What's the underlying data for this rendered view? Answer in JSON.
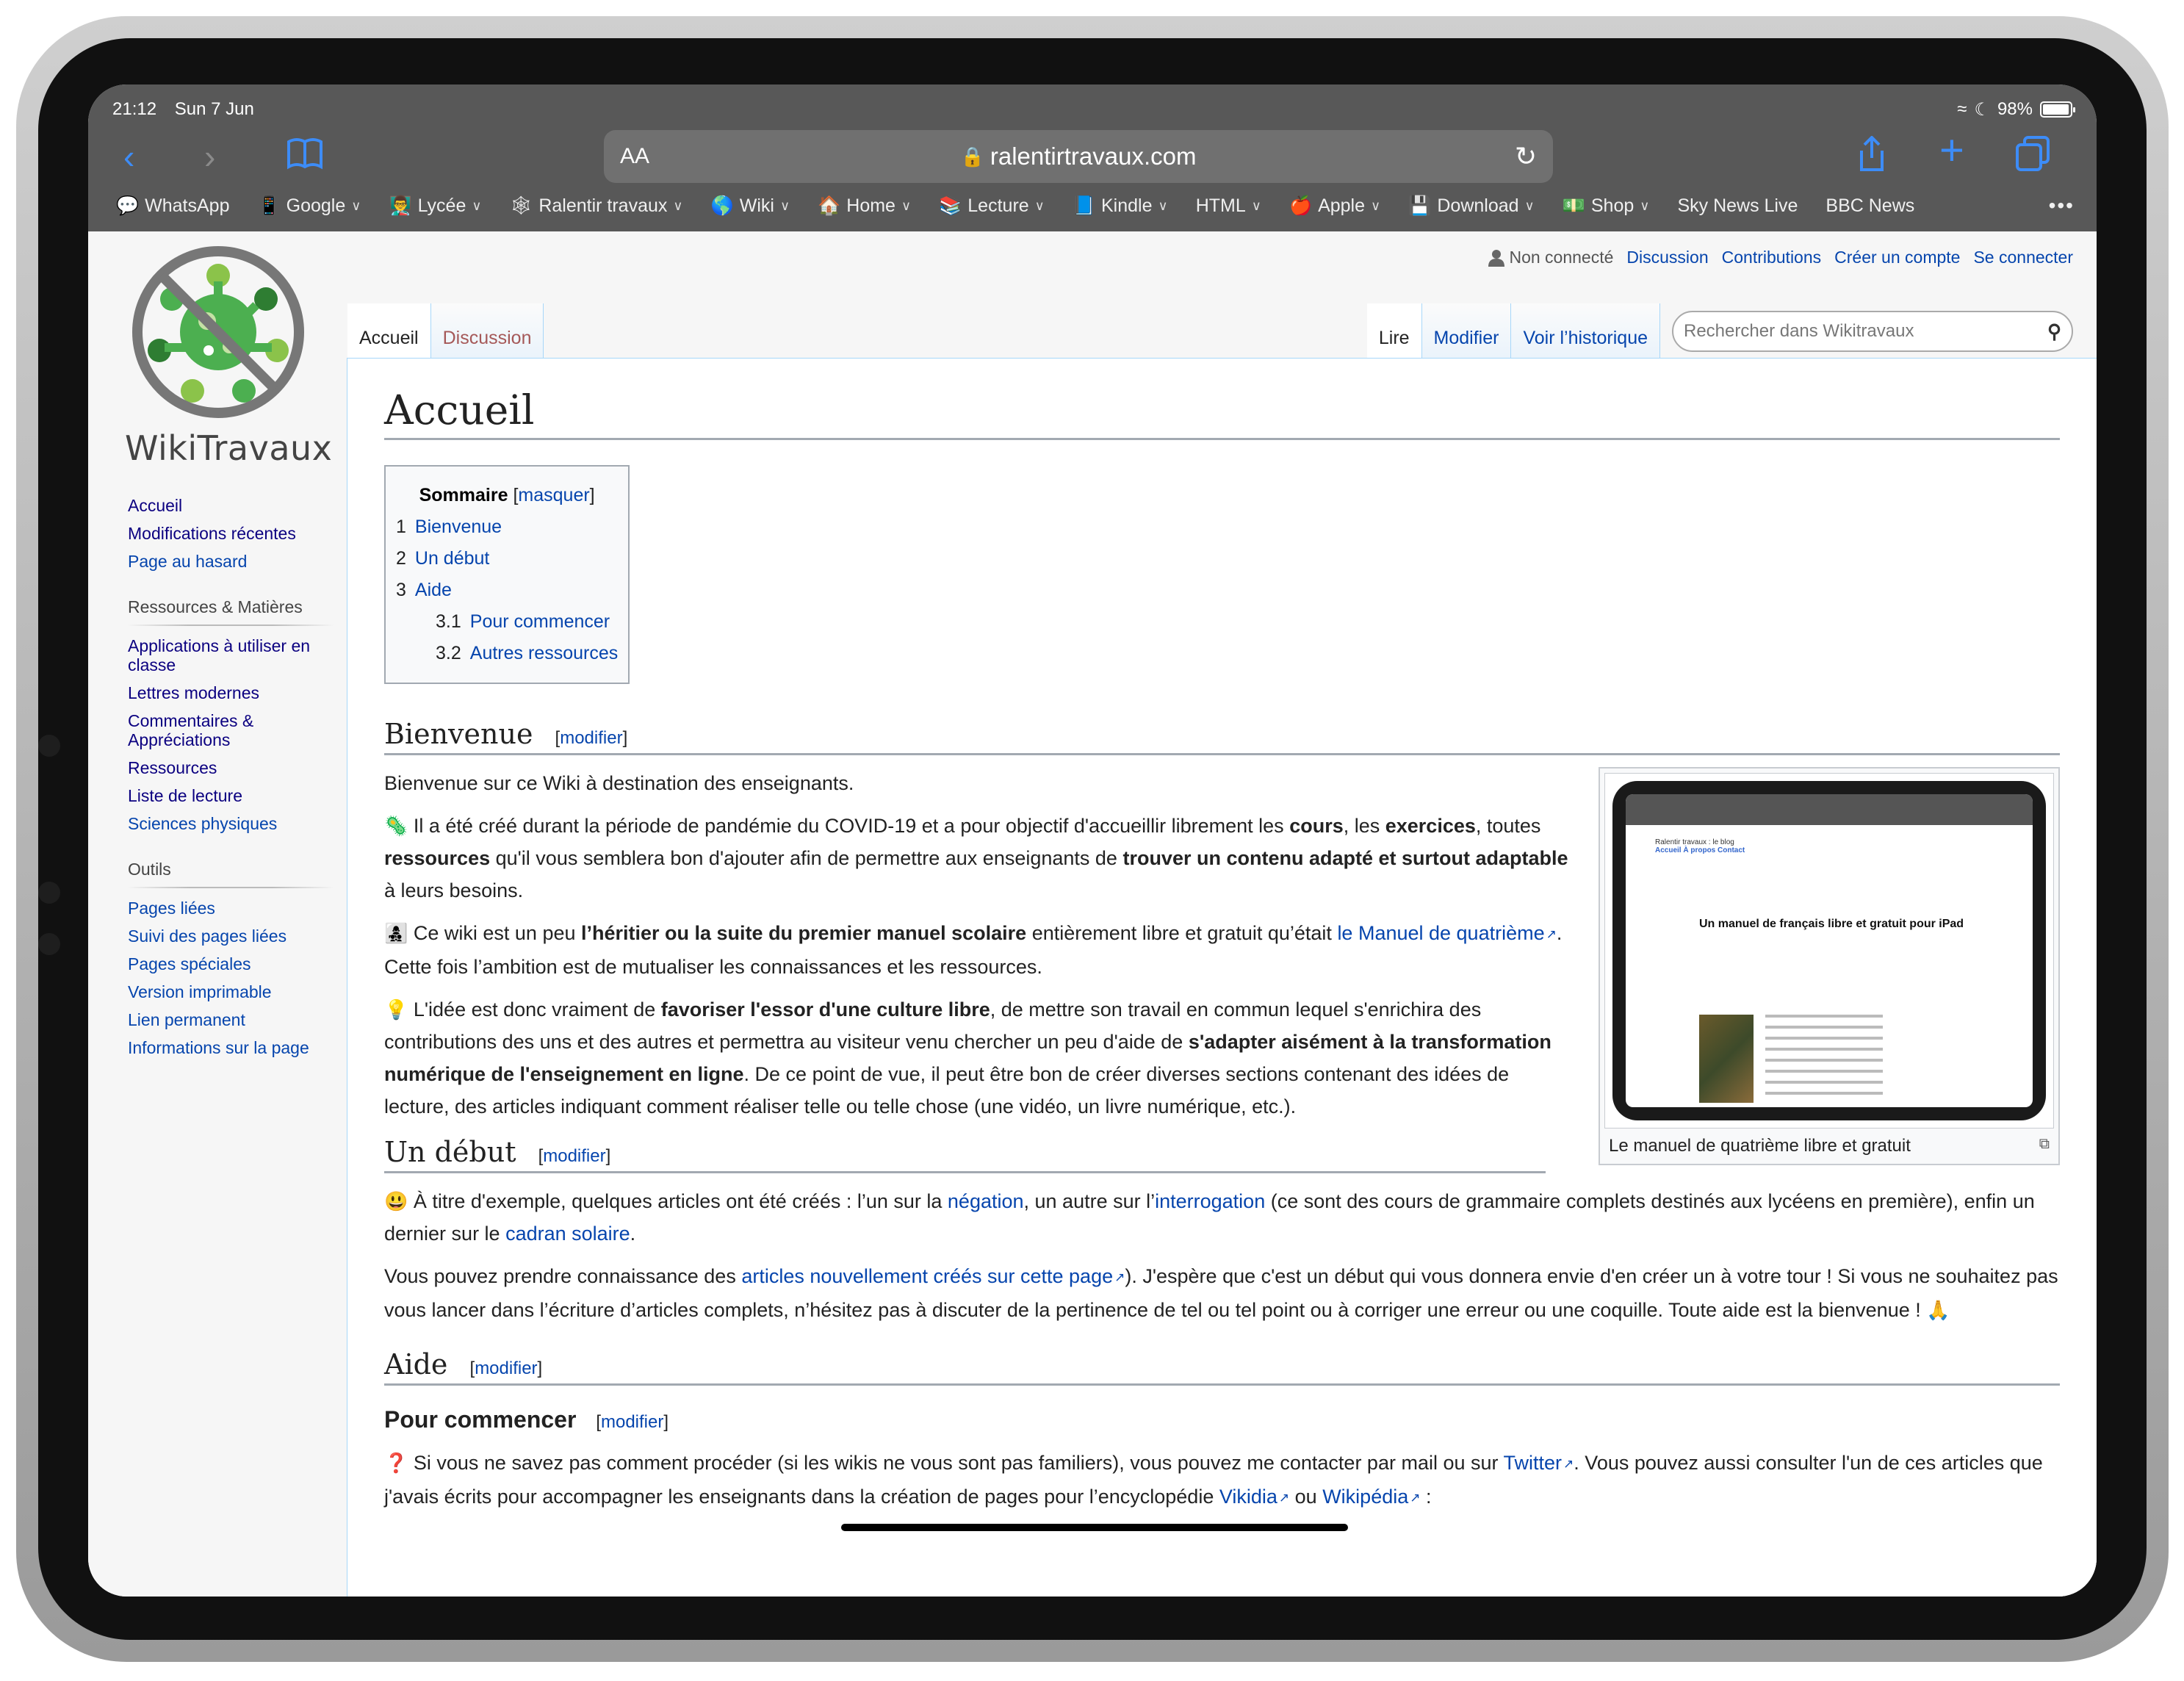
{
  "status_bar": {
    "time": "21:12",
    "date": "Sun 7 Jun",
    "battery": "98%",
    "battery_level": 0.98,
    "icons": [
      "wifi-icon",
      "moon-icon",
      "battery-icon"
    ]
  },
  "browser": {
    "url": "ralentirtravaux.com",
    "text_size_label": "AA",
    "icons": {
      "back": "‹",
      "forward": "›",
      "bookmarks": "book-icon",
      "share": "share-icon",
      "new_tab": "+",
      "tabs": "tabs-icon",
      "reload": "↻",
      "lock": "lock-icon"
    },
    "bookmarks": [
      {
        "label": "WhatsApp",
        "icon": "💬",
        "menu": false
      },
      {
        "label": "Google",
        "icon": "📱",
        "menu": true
      },
      {
        "label": "Lycée",
        "icon": "👨‍🏫",
        "menu": true
      },
      {
        "label": "Ralentir travaux",
        "icon": "🕸",
        "menu": true
      },
      {
        "label": "Wiki",
        "icon": "🌎",
        "menu": true
      },
      {
        "label": "Home",
        "icon": "🏠",
        "menu": true
      },
      {
        "label": "Lecture",
        "icon": "📚",
        "menu": true
      },
      {
        "label": "Kindle",
        "icon": "📘",
        "menu": true
      },
      {
        "label": "HTML",
        "icon": "",
        "menu": true
      },
      {
        "label": "Apple",
        "icon": "🍎",
        "menu": true
      },
      {
        "label": "Download",
        "icon": "💾",
        "menu": true
      },
      {
        "label": "Shop",
        "icon": "💵",
        "menu": true
      },
      {
        "label": "Sky News Live",
        "icon": "",
        "menu": false
      },
      {
        "label": "BBC News",
        "icon": "",
        "menu": false
      }
    ],
    "more_label": "•••"
  },
  "wiki": {
    "site_name": "WikiTravaux",
    "personal": {
      "status": "Non connecté",
      "links": [
        "Discussion",
        "Contributions",
        "Créer un compte",
        "Se connecter"
      ]
    },
    "namespace_tabs": [
      {
        "label": "Accueil",
        "selected": true
      },
      {
        "label": "Discussion",
        "selected": false
      }
    ],
    "view_tabs": [
      {
        "label": "Lire",
        "selected": true
      },
      {
        "label": "Modifier",
        "selected": false
      },
      {
        "label": "Voir l’historique",
        "selected": false
      }
    ],
    "search_placeholder": "Rechercher dans Wikitravaux",
    "sidebar": {
      "navigation": [
        "Accueil",
        "Modifications récentes",
        "Page au hasard"
      ],
      "ressources": {
        "title": "Ressources & Matières",
        "items": [
          "Applications à utiliser en classe",
          "Lettres modernes",
          "Commentaires & Appréciations",
          "Ressources",
          "Liste de lecture",
          "Sciences physiques"
        ]
      },
      "outils": {
        "title": "Outils",
        "items": [
          "Pages liées",
          "Suivi des pages liées",
          "Pages spéciales",
          "Version imprimable",
          "Lien permanent",
          "Informations sur la page"
        ]
      }
    },
    "page_title": "Accueil",
    "toc": {
      "title": "Sommaire",
      "toggle": "masquer",
      "entries": [
        {
          "num": "1",
          "label": "Bienvenue",
          "level": 1
        },
        {
          "num": "2",
          "label": "Un début",
          "level": 1
        },
        {
          "num": "3",
          "label": "Aide",
          "level": 1
        },
        {
          "num": "3.1",
          "label": "Pour commencer",
          "level": 2
        },
        {
          "num": "3.2",
          "label": "Autres ressources",
          "level": 2
        }
      ]
    },
    "edit_label": "modifier",
    "sections": {
      "bienvenue": {
        "title": "Bienvenue",
        "intro": "Bienvenue sur ce Wiki à destination des enseignants.",
        "p1": {
          "emoji": "🦠",
          "t1": " Il a été créé durant la période de pandémie du COVID-19 et a pour objectif d'accueillir librement les ",
          "b1": "cours",
          "t2": ", les ",
          "b2": "exercices",
          "t3": ", toutes ",
          "b3": "ressources",
          "t4": " qu'il vous semblera bon d'ajouter afin de permettre aux enseignants de ",
          "b4": "trouver un contenu adapté et surtout adaptable",
          "t5": " à leurs besoins."
        },
        "p2": {
          "emoji": "👩‍👧‍👦",
          "t1": " Ce wiki est un peu ",
          "b1": "l’héritier ou la suite du premier manuel scolaire",
          "t2": " entièrement libre et gratuit qu’était ",
          "link": "le Manuel de quatrième",
          "t3": ". Cette fois l’ambition est de mutualiser les connaissances et les ressources."
        },
        "p3": {
          "emoji": "💡",
          "t1": " L'idée est donc vraiment de ",
          "b1": "favoriser l'essor d'une culture libre",
          "t2": ", de mettre son travail en commun lequel s'enrichira des contributions des uns et des autres et permettra au visiteur venu chercher un peu d'aide de ",
          "b2": "s'adapter aisément à la transformation numérique de l'enseignement en ligne",
          "t3": ". De ce point de vue, il peut être bon de créer diverses sections contenant des idées de lecture, des articles indiquant comment réaliser telle ou telle chose (une vidéo, un livre numérique, etc.)."
        },
        "thumb": {
          "caption": "Le manuel de quatrième libre et gratuit",
          "inner_blog": "Ralentir travaux : le blog",
          "inner_nav": "Accueil  À propos  Contact",
          "inner_title": "Un manuel de français libre et gratuit pour iPad"
        }
      },
      "debut": {
        "title": "Un début",
        "p1": {
          "emoji": "😃",
          "t1": " À titre d'exemple, quelques articles ont été créés : l’un sur la ",
          "l1": "négation",
          "t2": ", un autre sur l’",
          "l2": "interrogation",
          "t3": " (ce sont des cours de grammaire complets destinés aux lycéens en première), enfin un dernier sur le ",
          "l3": "cadran solaire",
          "t4": "."
        },
        "p2": {
          "t1": "Vous pouvez prendre connaissance des ",
          "l1": "articles nouvellement créés sur cette page",
          "t2": "). J'espère que c'est un début qui vous donnera envie d'en créer un à votre tour ! Si vous ne souhaitez pas vous lancer dans l’écriture d’articles complets, n’hésitez pas à discuter de la pertinence de tel ou tel point ou à corriger une erreur ou une coquille. Toute aide est la bienvenue ! ",
          "emoji": "🙏"
        }
      },
      "aide": {
        "title": "Aide",
        "sub1": {
          "title": "Pour commencer",
          "p1": {
            "emoji": "❓",
            "t1": " Si vous ne savez pas comment procéder (si les wikis ne vous sont pas familiers), vous pouvez me contacter par mail ou sur ",
            "l1": "Twitter",
            "t2": ". Vous pouvez aussi consulter l'un de ces articles que j'avais écrits pour accompagner les enseignants dans la création de pages pour l’encyclopédie ",
            "l2": "Vikidia",
            "t3": " ou ",
            "l3": "Wikipédia",
            "t4": " :"
          }
        }
      }
    }
  }
}
